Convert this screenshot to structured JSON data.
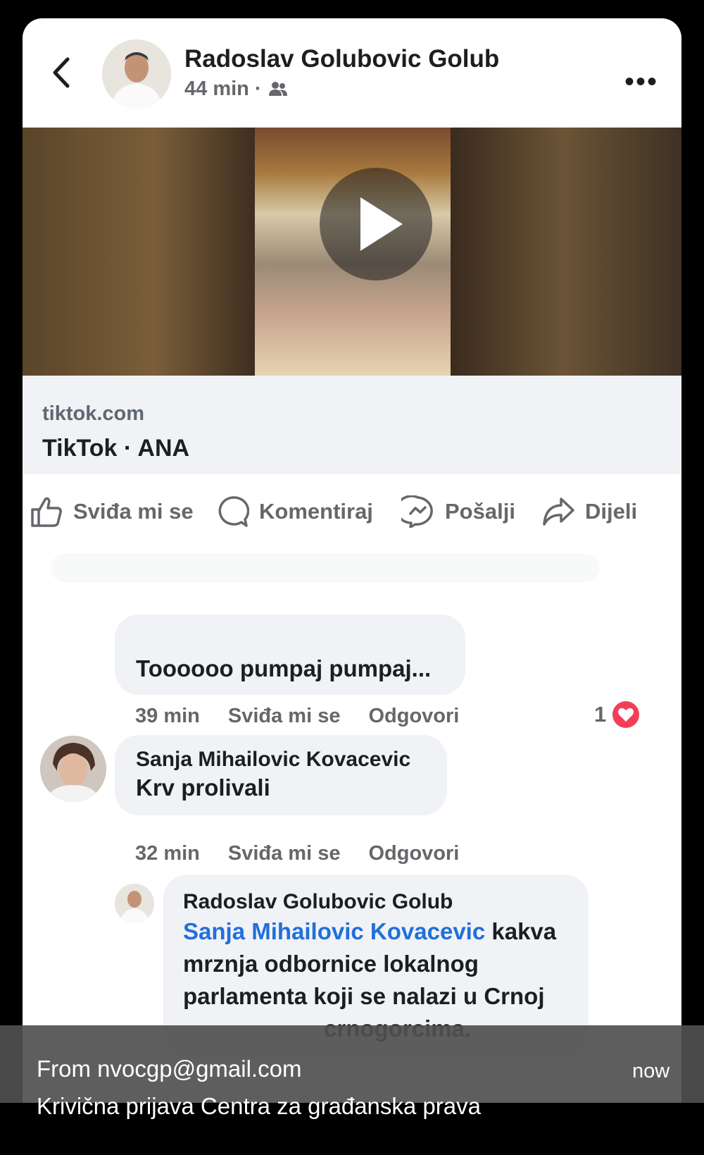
{
  "post": {
    "author": "Radoslav Golubovic Golub",
    "time": "44 min",
    "separator": "·",
    "audience_icon": "friends-icon",
    "more_icon": "more-icon"
  },
  "link": {
    "domain": "tiktok.com",
    "title": "TikTok · ANA"
  },
  "actions": {
    "like": "Sviđa mi se",
    "comment": "Komentiraj",
    "send": "Pošalji",
    "share": "Dijeli"
  },
  "comments": [
    {
      "text": "Toooooo pumpaj pumpaj...",
      "time": "39 min",
      "like": "Sviđa mi se",
      "reply": "Odgovori",
      "reactions": "1"
    },
    {
      "name": "Sanja Mihailovic Kovacevic",
      "text": "Krv prolivali",
      "time": "32 min",
      "like": "Sviđa mi se",
      "reply": "Odgovori"
    },
    {
      "name": "Radoslav Golubovic Golub",
      "mention": "Sanja Mihailovic Kovacevic",
      "text_line1": "kakva",
      "text_line2": "mrznja odbornice lokalnog",
      "text_line3": "parlamenta koji se nalazi u Crnoj",
      "text_line4": "crnogorcima."
    }
  ],
  "notification": {
    "from": "From nvocgp@gmail.com",
    "time": "now",
    "subject": "Krivična prijava Centra za građanska prava"
  },
  "colors": {
    "link_blue": "#216fdb",
    "meta_gray": "#65676b",
    "heart_red": "#f33e58"
  }
}
